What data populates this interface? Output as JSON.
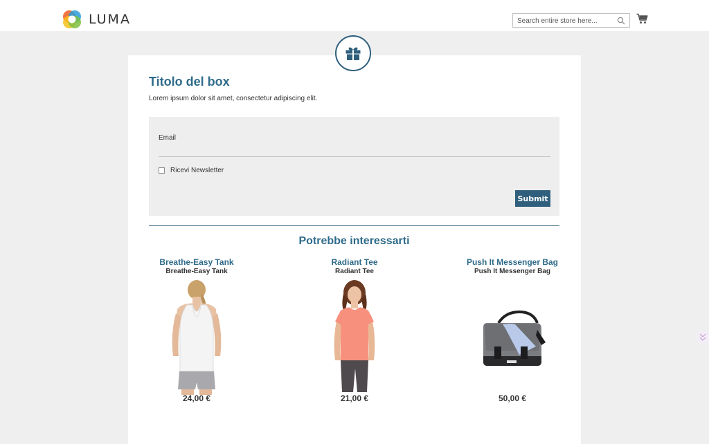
{
  "header": {
    "logo_text": "LUMA",
    "search": {
      "placeholder": "Search entire store here..."
    },
    "icons": {
      "search": "search-icon",
      "cart": "cart-icon"
    }
  },
  "newsletter": {
    "icon": "gift-icon",
    "title": "Titolo del box",
    "subtitle": "Lorem ipsum dolor sit amet, consectetur adipiscing elit.",
    "email_label": "Email",
    "email_value": "",
    "checkbox_label": "Ricevi Newsletter",
    "checkbox_checked": false,
    "submit_label": "Submit"
  },
  "recommendations": {
    "title": "Potrebbe interessarti",
    "products": [
      {
        "title": "Breathe-Easy Tank",
        "subtitle": "Breathe-Easy Tank",
        "price": "24,00 €"
      },
      {
        "title": "Radiant Tee",
        "subtitle": "Radiant Tee",
        "price": "21,00 €"
      },
      {
        "title": "Push It Messenger Bag",
        "subtitle": "Push It Messenger Bag",
        "price": "50,00 €"
      }
    ]
  },
  "colors": {
    "accent": "#2f5f7c",
    "heading": "#2f6b8a",
    "page_bg": "#efefef",
    "panel_bg": "#eeeeee"
  }
}
